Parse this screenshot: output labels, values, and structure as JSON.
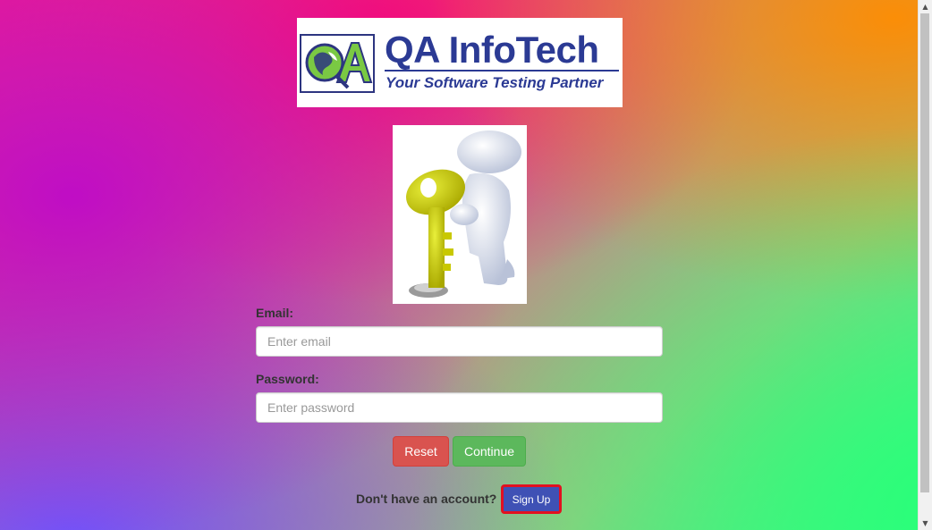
{
  "logo": {
    "title": "QA InfoTech",
    "tagline": "Your Software Testing Partner",
    "emblem_letters": "QA",
    "brand_color": "#2b3a94"
  },
  "illustration": {
    "icon": "person-holding-key-icon"
  },
  "form": {
    "email_label": "Email:",
    "email_placeholder": "Enter email",
    "email_value": "",
    "password_label": "Password:",
    "password_placeholder": "Enter password",
    "password_value": "",
    "reset_label": "Reset",
    "continue_label": "Continue"
  },
  "signup": {
    "prompt": "Don't have an account?",
    "button_label": "Sign Up"
  },
  "colors": {
    "reset": "#d9534f",
    "continue": "#5cb85c",
    "signup": "#3f51b5",
    "signup_highlight": "#e21020"
  }
}
